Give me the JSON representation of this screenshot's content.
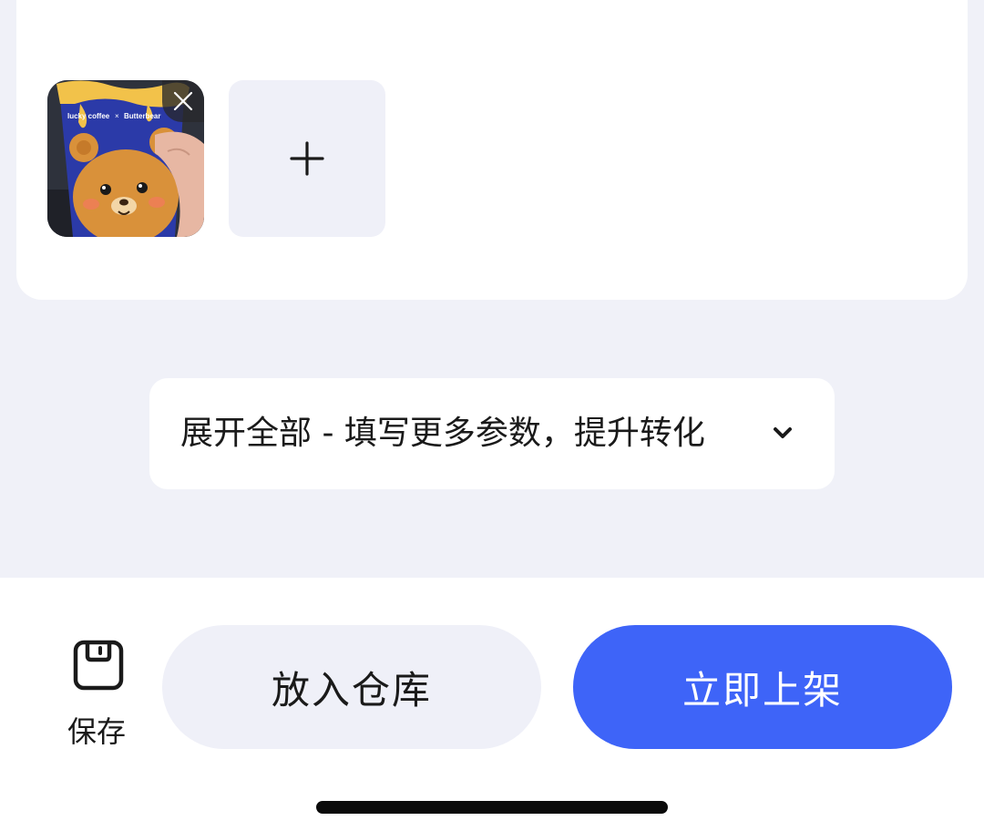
{
  "images": {
    "thumbnail": {
      "caption_left": "lucky coffee",
      "caption_sep": "×",
      "caption_right": "Butterbear",
      "remove_icon": "close-icon"
    },
    "add_icon": "plus-icon"
  },
  "expand": {
    "label": "展开全部 - 填写更多参数，提升转化",
    "icon": "chevron-down-icon"
  },
  "bottom_bar": {
    "save_label": "保存",
    "save_icon": "floppy-disk-icon",
    "warehouse_label": "放入仓库",
    "publish_label": "立即上架"
  },
  "colors": {
    "page_bg": "#f0f1f8",
    "card_bg": "#ffffff",
    "secondary_button": "#eff0f8",
    "primary_button": "#3e64f8"
  }
}
